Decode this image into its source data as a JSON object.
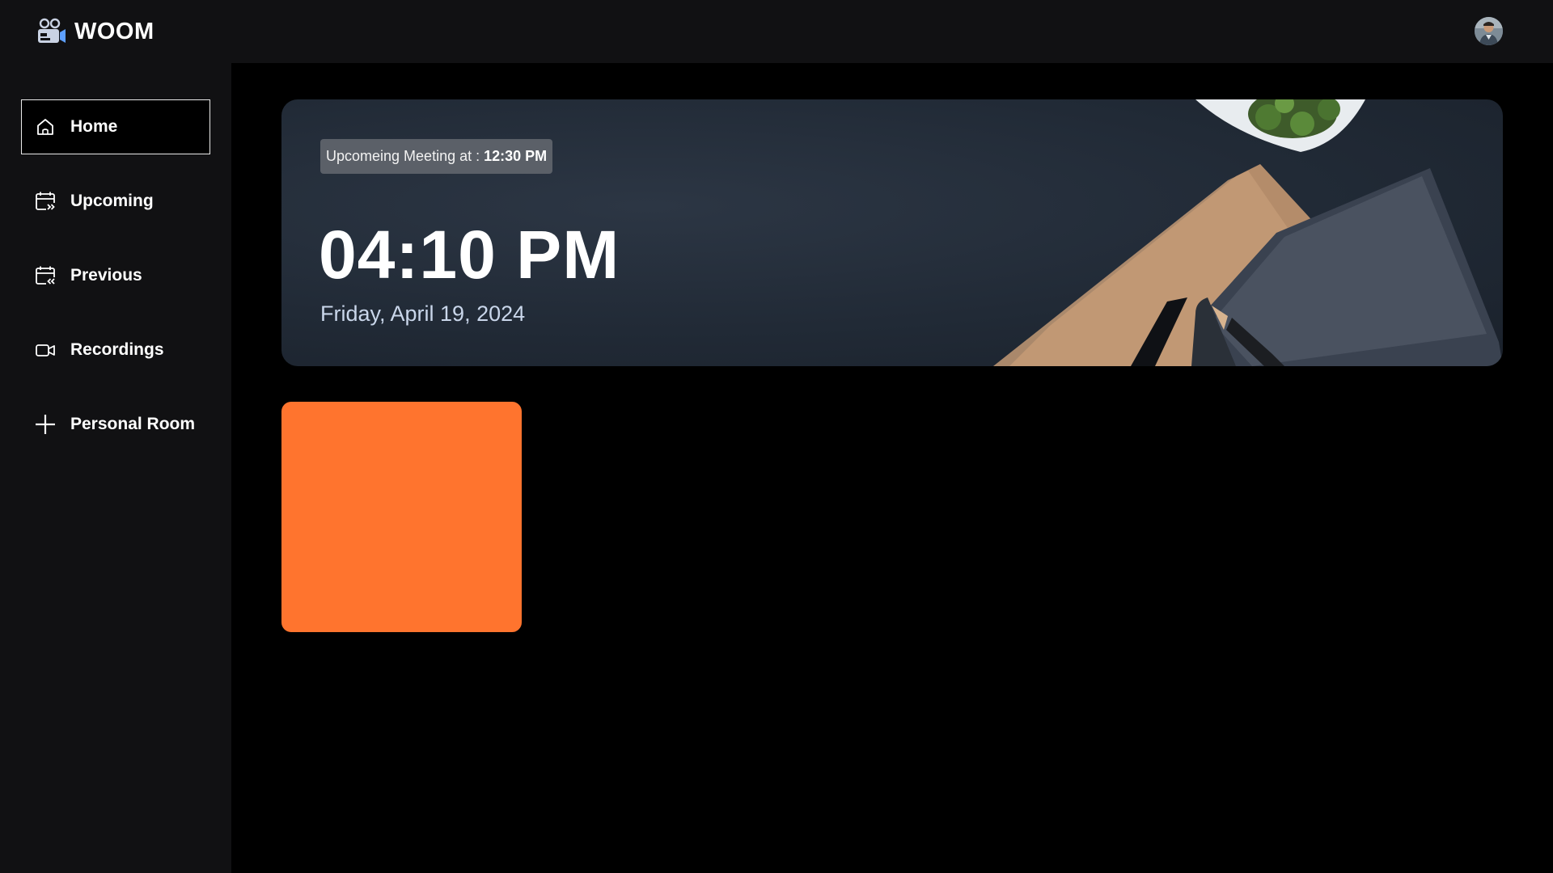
{
  "app": {
    "name": "WOOM"
  },
  "sidebar": {
    "items": [
      {
        "label": "Home",
        "icon": "home-icon"
      },
      {
        "label": "Upcoming",
        "icon": "calendar-upcoming-icon"
      },
      {
        "label": "Previous",
        "icon": "calendar-previous-icon"
      },
      {
        "label": "Recordings",
        "icon": "video-camera-icon"
      },
      {
        "label": "Personal Room",
        "icon": "plus-icon"
      }
    ]
  },
  "hero": {
    "badge_prefix": "Upcomeing Meeting at :",
    "badge_time": "12:30 PM",
    "time": "04:10 PM",
    "date": "Friday, April 19, 2024"
  },
  "colors": {
    "sidebar_bg": "#111113",
    "main_bg": "#000000",
    "card_accent": "#ff742e",
    "date_text": "#c9d6ea"
  }
}
